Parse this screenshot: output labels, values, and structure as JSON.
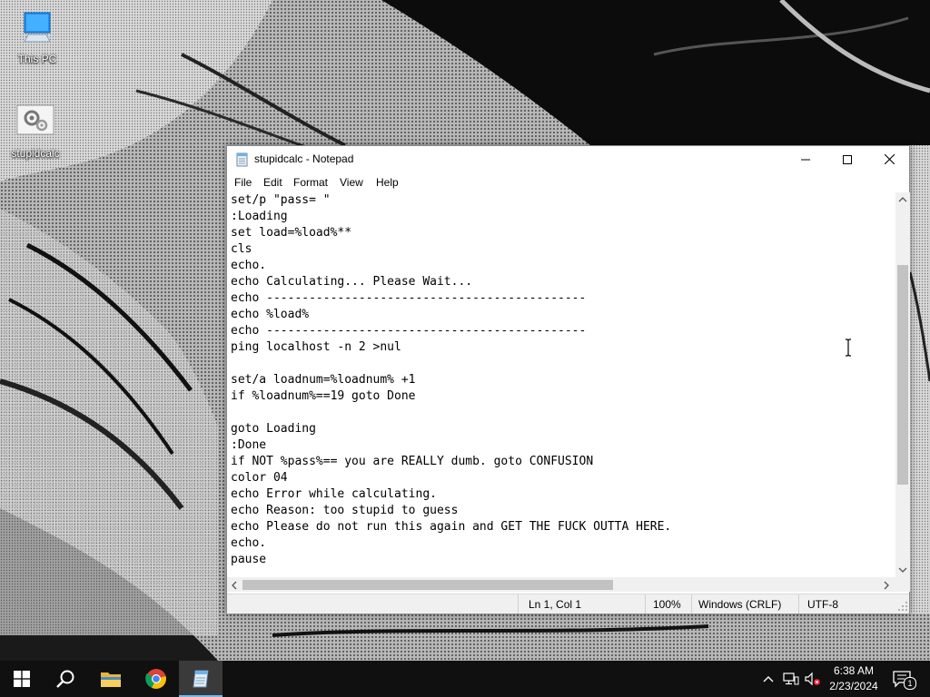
{
  "desktop": {
    "icons": [
      {
        "label": "This PC",
        "icon": "this-pc-icon"
      },
      {
        "label": "stupidcalc",
        "icon": "batch-file-icon"
      }
    ]
  },
  "window": {
    "title": "stupidcalc - Notepad",
    "menu": [
      "File",
      "Edit",
      "Format",
      "View",
      "Help"
    ],
    "content_lines": [
      "set/p \"pass= \"",
      ":Loading",
      "set load=%load%**",
      "cls",
      "echo.",
      "echo Calculating... Please Wait...",
      "echo ---------------------------------------------",
      "echo %load%",
      "echo ---------------------------------------------",
      "ping localhost -n 2 >nul",
      "",
      "set/a loadnum=%loadnum% +1",
      "if %loadnum%==19 goto Done",
      "",
      "goto Loading",
      ":Done",
      "if NOT %pass%== you are REALLY dumb. goto CONFUSION",
      "color 04",
      "echo Error while calculating.",
      "echo Reason: too stupid to guess",
      "echo Please do not run this again and GET THE FUCK OUTTA HERE.",
      "echo.",
      "pause"
    ],
    "status": {
      "position": "Ln 1, Col 1",
      "zoom": "100%",
      "line_ending": "Windows (CRLF)",
      "encoding": "UTF-8"
    }
  },
  "taskbar": {
    "apps": [
      "start-icon",
      "search-icon",
      "file-explorer-icon",
      "chrome-icon",
      "notepad-icon"
    ],
    "active_app": "notepad-icon",
    "time": "6:38 AM",
    "date": "2/23/2024",
    "notification_count": "1"
  },
  "colors": {
    "taskbar": "#101010",
    "accent": "#76b9ed",
    "status_bar": "#f0f0f0"
  }
}
